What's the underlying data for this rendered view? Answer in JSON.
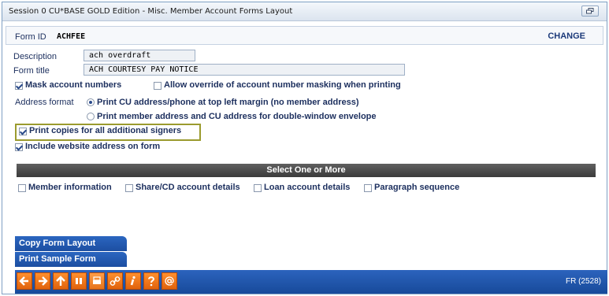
{
  "window": {
    "title": "Session 0 CU*BASE GOLD Edition - Misc. Member Account Forms Layout"
  },
  "header": {
    "form_id_label": "Form ID",
    "form_id_value": "ACHFEE",
    "mode": "CHANGE"
  },
  "fields": {
    "description": {
      "label": "Description",
      "value": "ach overdraft"
    },
    "form_title": {
      "label": "Form title",
      "value": "ACH COURTESY PAY NOTICE"
    }
  },
  "options": {
    "mask_account_numbers": {
      "label": "Mask account numbers",
      "checked": true
    },
    "allow_override_masking": {
      "label": "Allow override of account number masking when printing",
      "checked": false
    },
    "address_format_label": "Address format",
    "address_format_options": [
      {
        "label": "Print CU address/phone at top left margin (no member address)",
        "selected": true
      },
      {
        "label": "Print member address and CU address for double-window envelope",
        "selected": false
      }
    ],
    "print_copies_additional_signers": {
      "label": "Print copies for all additional signers",
      "checked": true
    },
    "include_website_address": {
      "label": "Include website address on form",
      "checked": true
    }
  },
  "select_section": {
    "title": "Select One or More",
    "items": [
      {
        "label": "Member information",
        "checked": false
      },
      {
        "label": "Share/CD account details",
        "checked": false
      },
      {
        "label": "Loan account details",
        "checked": false
      },
      {
        "label": "Paragraph sequence",
        "checked": false
      }
    ]
  },
  "actions": [
    {
      "label": "Copy Form Layout"
    },
    {
      "label": "Print Sample Form"
    }
  ],
  "toolbar": {
    "icons": [
      "back-arrow-icon",
      "forward-arrow-icon",
      "up-arrow-icon",
      "pause-icon",
      "print-icon",
      "link-icon",
      "info-icon",
      "help-icon",
      "at-icon"
    ],
    "screen_id": "FR (2528)"
  },
  "colors": {
    "toolbar_blue": "#1c4ea1",
    "tool_orange": "#f07a1c",
    "highlight_olive": "#9b9b2e",
    "section_bar": "#4a4a4a"
  }
}
